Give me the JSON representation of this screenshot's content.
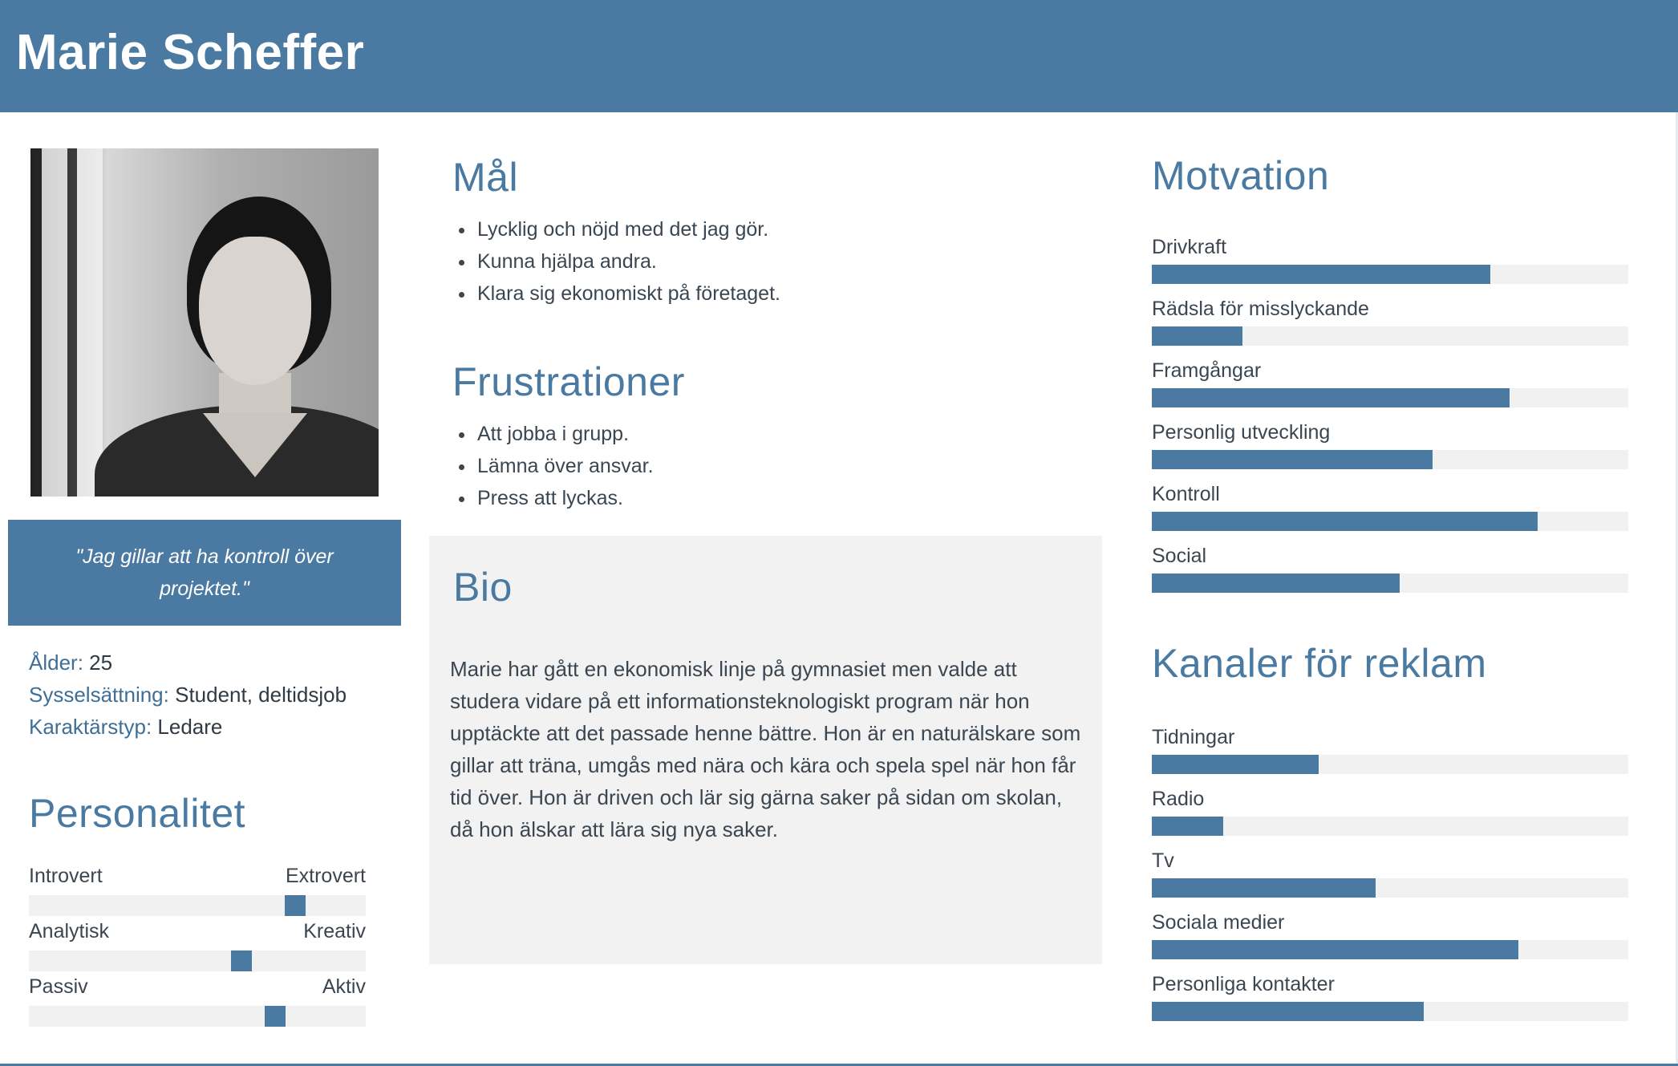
{
  "header": {
    "name": "Marie Scheffer"
  },
  "quote": "\"Jag gillar att ha kontroll över projektet.\"",
  "facts": [
    {
      "key": "Ålder:",
      "value": "25"
    },
    {
      "key": "Sysselsättning:",
      "value": "Student, deltidsjob"
    },
    {
      "key": "Karaktärstyp:",
      "value": "Ledare"
    }
  ],
  "personality": {
    "title": "Personalitet",
    "scales": [
      {
        "left": "Introvert",
        "right": "Extrovert",
        "position": 0.79
      },
      {
        "left": "Analytisk",
        "right": "Kreativ",
        "position": 0.63
      },
      {
        "left": "Passiv",
        "right": "Aktiv",
        "position": 0.73
      }
    ]
  },
  "goals": {
    "title": "Mål",
    "items": [
      "Lycklig och nöjd med det jag gör.",
      "Kunna hjälpa andra.",
      "Klara sig ekonomiskt på företaget."
    ]
  },
  "frustrations": {
    "title": "Frustrationer",
    "items": [
      "Att jobba i grupp.",
      "Lämna över ansvar.",
      "Press att lyckas."
    ]
  },
  "bio": {
    "title": "Bio",
    "text": "Marie har gått en ekonomisk linje på gymnasiet men valde att studera vidare på ett informationsteknologiskt program när hon upptäckte att det passade henne bättre. Hon är en naturälskare som gillar att träna, umgås med nära och kära och spela spel när hon får tid över. Hon är driven och lär sig gärna saker på sidan om skolan, då hon älskar att lära sig nya saker."
  },
  "motivation": {
    "title": "Motvation",
    "bars": [
      {
        "label": "Drivkraft",
        "value": 0.71
      },
      {
        "label": "Rädsla för misslyckande",
        "value": 0.19
      },
      {
        "label": "Framgångar",
        "value": 0.75
      },
      {
        "label": "Personlig utveckling",
        "value": 0.59
      },
      {
        "label": "Kontroll",
        "value": 0.81
      },
      {
        "label": "Social",
        "value": 0.52
      }
    ]
  },
  "channels": {
    "title": "Kanaler för reklam",
    "bars": [
      {
        "label": "Tidningar",
        "value": 0.35
      },
      {
        "label": "Radio",
        "value": 0.15
      },
      {
        "label": "Tv",
        "value": 0.47
      },
      {
        "label": "Sociala medier",
        "value": 0.77
      },
      {
        "label": "Personliga kontakter",
        "value": 0.57
      }
    ]
  },
  "colors": {
    "accent": "#4a7aa1",
    "track": "#f1f1f1",
    "bio_bg": "#f2f2f2",
    "text": "#3b4650"
  }
}
